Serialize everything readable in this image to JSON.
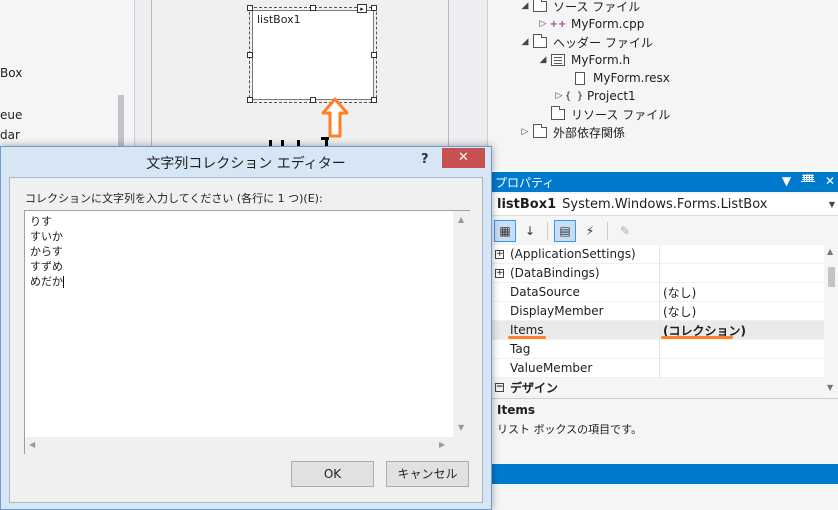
{
  "toolbox": {
    "items": [
      "Box",
      "eue",
      "dar"
    ]
  },
  "designer": {
    "listbox_name": "listBox1"
  },
  "solution_explorer": {
    "items": [
      {
        "label": "ソース ファイル",
        "type": "folder"
      },
      {
        "label": "MyForm.cpp",
        "type": "cpp"
      },
      {
        "label": "ヘッダー ファイル",
        "type": "folder"
      },
      {
        "label": "MyForm.h",
        "type": "form"
      },
      {
        "label": "MyForm.resx",
        "type": "file"
      },
      {
        "label": "Project1",
        "type": "ns"
      },
      {
        "label": "リソース ファイル",
        "type": "folder"
      },
      {
        "label": "外部依存関係",
        "type": "deps"
      }
    ]
  },
  "properties": {
    "panel_title": "プロパティ",
    "title_buttons": [
      "▼",
      "ᚙ",
      "✕"
    ],
    "object_name": "listBox1",
    "object_type": "System.Windows.Forms.ListBox",
    "rows": [
      {
        "name": "(ApplicationSettings)",
        "value": "",
        "expander": "+"
      },
      {
        "name": "(DataBindings)",
        "value": "",
        "expander": "+"
      },
      {
        "name": "DataSource",
        "value": "(なし)"
      },
      {
        "name": "DisplayMember",
        "value": "(なし)"
      },
      {
        "name": "Items",
        "value": "(コレクション)"
      },
      {
        "name": "Tag",
        "value": ""
      },
      {
        "name": "ValueMember",
        "value": ""
      }
    ],
    "category": "デザイン",
    "description_title": "Items",
    "description_text": "リスト ボックスの項目です。",
    "highlight_color": "#ff7f27",
    "accent_color": "#007acc"
  },
  "dialog": {
    "title": "文字列コレクション エディター",
    "help_label": "?",
    "close_label": "✕",
    "prompt": "コレクションに文字列を入力してください (各行に 1 つ)(E):",
    "lines": [
      "りす",
      "すいか",
      "からす",
      "すずめ",
      "めだか"
    ],
    "ok_label": "OK",
    "cancel_label": "キャンセル"
  }
}
